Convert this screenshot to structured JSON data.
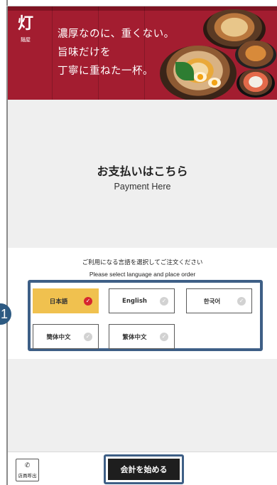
{
  "banner": {
    "logo_kanji": "灯",
    "logo_sub": "麺屋",
    "catch_lines": [
      "濃厚なのに、重くない。",
      "旨味だけを",
      "丁寧に重ねた一杯。"
    ]
  },
  "payment": {
    "title_jp": "お支払いはこちら",
    "title_en": "Payment Here"
  },
  "language": {
    "instruction_jp": "ご利用になる言語を選択してご注文ください",
    "instruction_en": "Please select language and place order",
    "options": [
      {
        "label": "日本語",
        "selected": true
      },
      {
        "label": "English",
        "selected": false
      },
      {
        "label": "한국어",
        "selected": false
      },
      {
        "label": "簡体中文",
        "selected": false
      },
      {
        "label": "繁体中文",
        "selected": false
      }
    ]
  },
  "footer": {
    "call_staff_label": "店員呼出",
    "start_checkout_label": "会計を始める"
  },
  "annotation": {
    "step_number": "1"
  },
  "colors": {
    "banner_red": "#a31d30",
    "highlight_blue": "#3e5f86",
    "selected_yellow": "#f0c14f",
    "check_red": "#d6262f",
    "start_button": "#1e1e1e"
  }
}
